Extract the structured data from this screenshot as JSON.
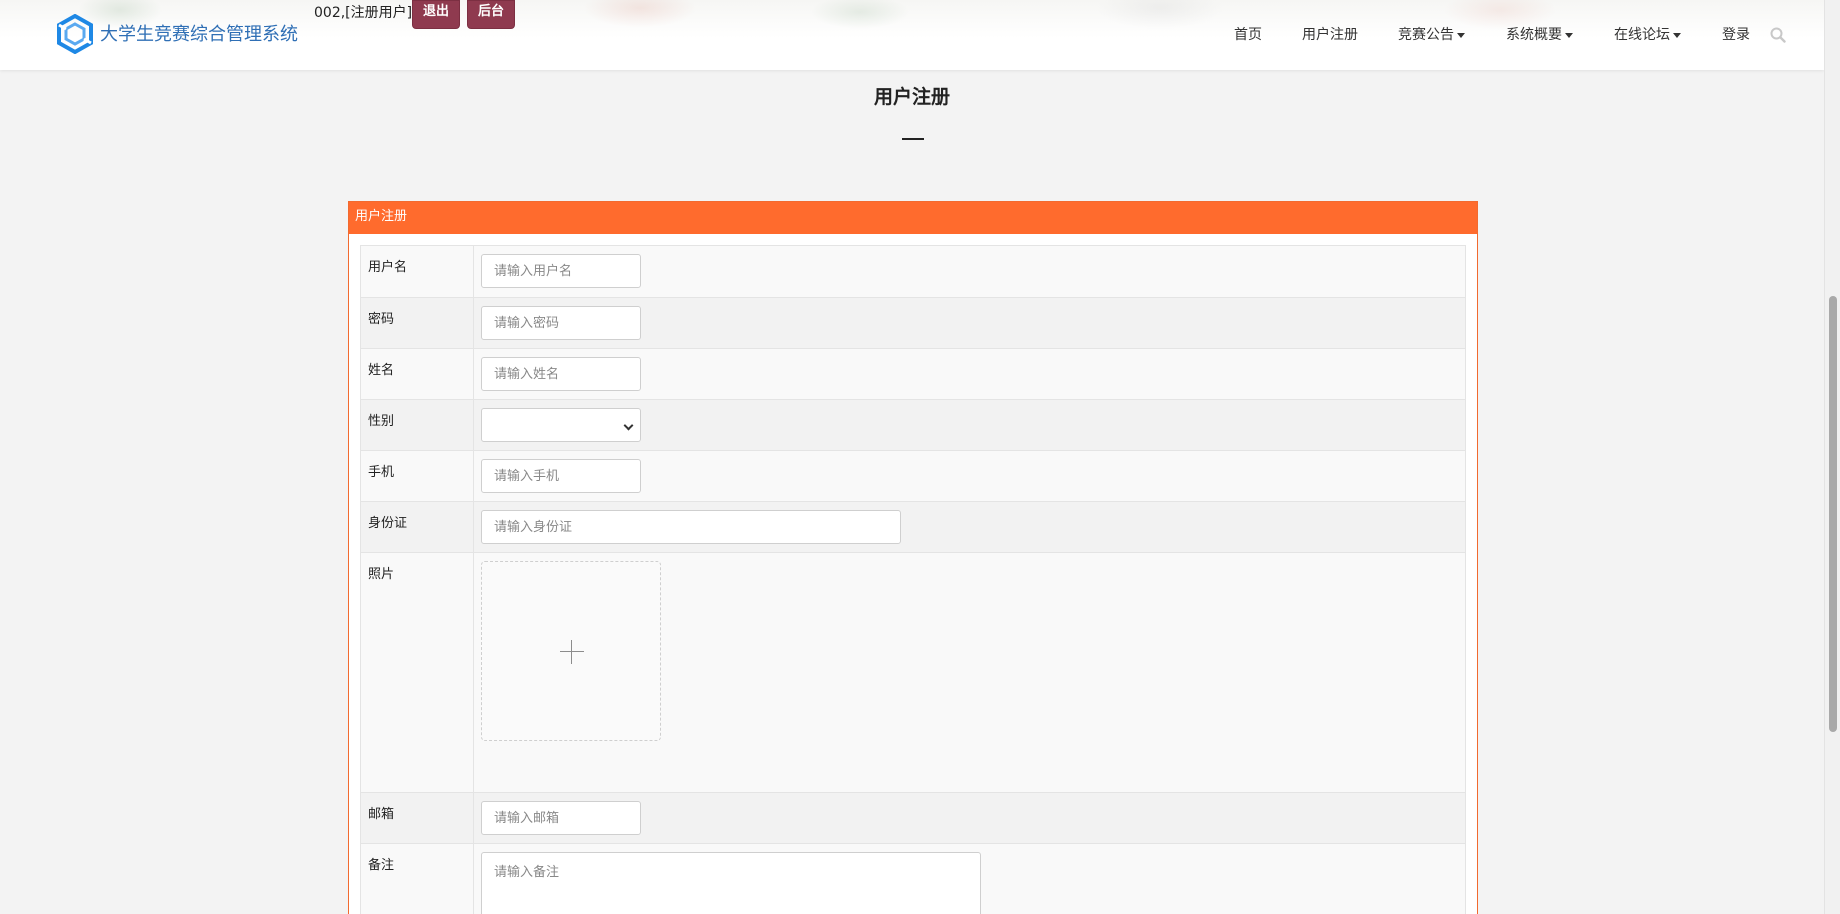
{
  "header": {
    "site_title": "大学生竞赛综合管理系统",
    "user_info": "002,[注册用户]",
    "logout_label": "退出",
    "admin_label": "后台",
    "nav": {
      "home": "首页",
      "register": "用户注册",
      "announce": "竞赛公告",
      "overview": "系统概要",
      "forum": "在线论坛",
      "login": "登录"
    },
    "search_icon": "search-icon"
  },
  "page": {
    "title": "用户注册"
  },
  "panel": {
    "heading": "用户注册",
    "fields": {
      "username": {
        "label": "用户名",
        "placeholder": "请输入用户名"
      },
      "password": {
        "label": "密码",
        "placeholder": "请输入密码"
      },
      "name": {
        "label": "姓名",
        "placeholder": "请输入姓名"
      },
      "gender": {
        "label": "性别",
        "value": ""
      },
      "phone": {
        "label": "手机",
        "placeholder": "请输入手机"
      },
      "idcard": {
        "label": "身份证",
        "placeholder": "请输入身份证"
      },
      "photo": {
        "label": "照片"
      },
      "email": {
        "label": "邮箱",
        "placeholder": "请输入邮箱"
      },
      "remark": {
        "label": "备注",
        "placeholder": "请输入备注"
      }
    }
  },
  "colors": {
    "accent": "#ff6b2d",
    "title_blue": "#2f6fb5",
    "button_maroon": "#8f3a4f"
  }
}
